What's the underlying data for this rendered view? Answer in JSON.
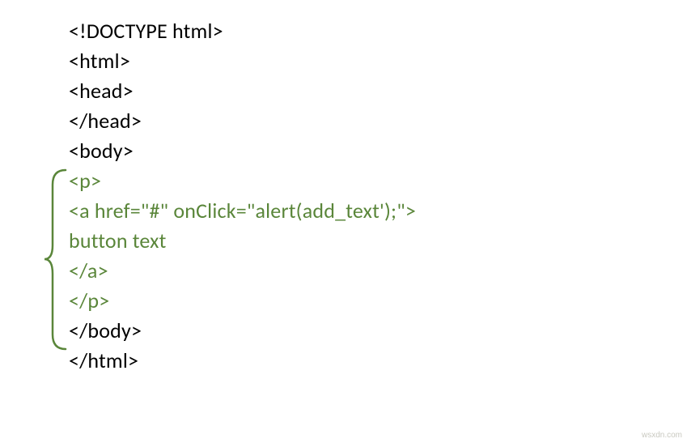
{
  "code": {
    "l1": "<!DOCTYPE html>",
    "l2": "<html>",
    "l3": "<head>",
    "l4": "</head>",
    "l5": "<body>",
    "l6": "<p>",
    "l7": "<a href=\"#\" onClick=\"alert(add_text');\">",
    "l8": "button text",
    "l9": " </a>",
    "l10": " </p>",
    "l11": "</body>",
    "l12": "</html>"
  },
  "watermark": "wsxdn.com"
}
